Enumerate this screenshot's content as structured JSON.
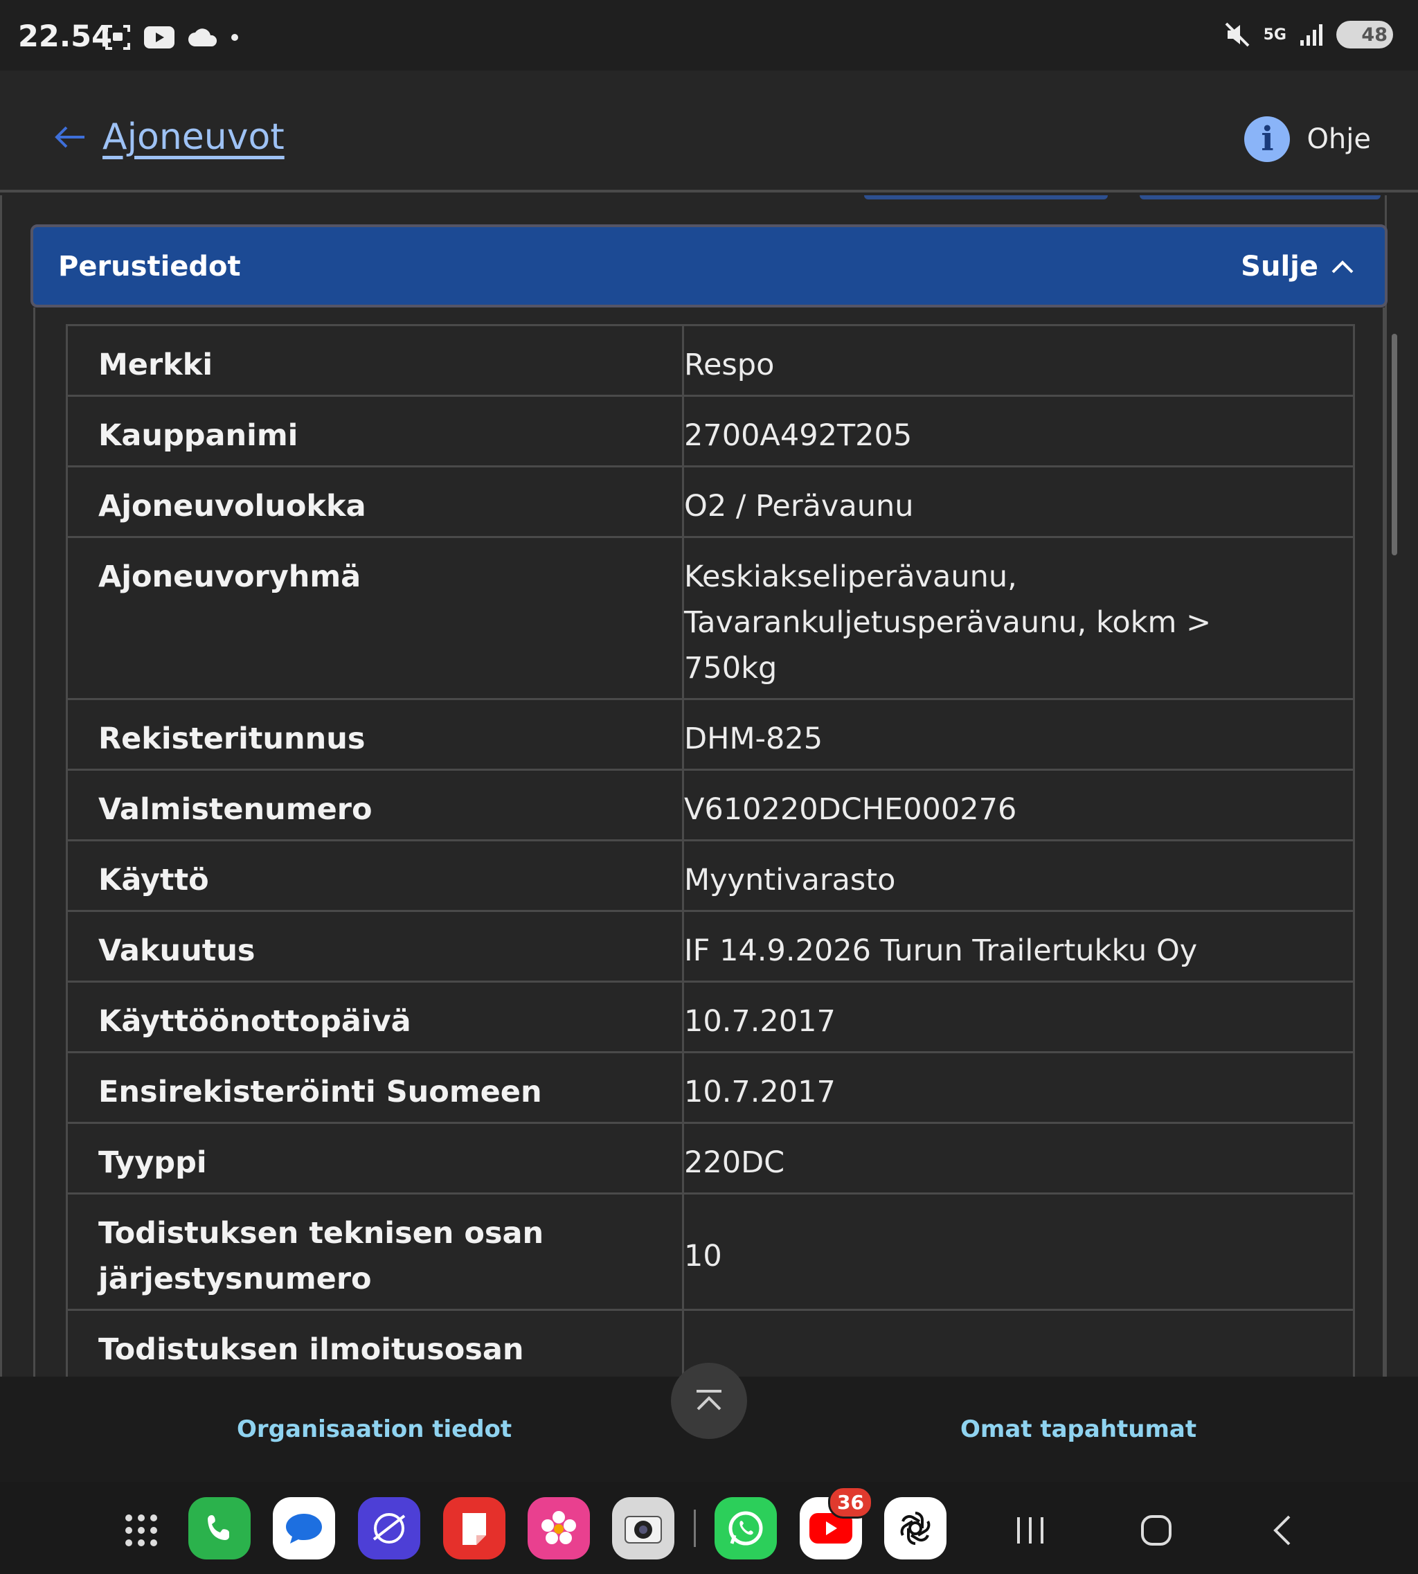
{
  "status_bar": {
    "time": "22.54",
    "network": "5G",
    "battery": "48"
  },
  "header": {
    "back_label": "Ajoneuvot",
    "help_label": "Ohje",
    "help_glyph": "i"
  },
  "section": {
    "title": "Perustiedot",
    "collapse_label": "Sulje"
  },
  "details": [
    {
      "label": "Merkki",
      "value": "Respo"
    },
    {
      "label": "Kauppanimi",
      "value": "2700A492T205"
    },
    {
      "label": "Ajoneuvoluokka",
      "value": "O2 / Perävaunu"
    },
    {
      "label": "Ajoneuvoryhmä",
      "value": "Keskiakseliperävaunu, Tavarankuljetusperävaunu, kokm > 750kg"
    },
    {
      "label": "Rekisteritunnus",
      "value": "DHM-825"
    },
    {
      "label": "Valmistenumero",
      "value": "V610220DCHE000276"
    },
    {
      "label": "Käyttö",
      "value": "Myyntivarasto"
    },
    {
      "label": "Vakuutus",
      "value": "IF 14.9.2026 Turun Trailertukku Oy"
    },
    {
      "label": "Käyttöönottopäivä",
      "value": "10.7.2017"
    },
    {
      "label": "Ensirekisteröinti Suomeen",
      "value": "10.7.2017"
    },
    {
      "label": "Tyyppi",
      "value": "220DC"
    },
    {
      "label": "Todistuksen teknisen osan järjestysnumero",
      "value": "10"
    },
    {
      "label": "Todistuksen ilmoitusosan",
      "value": ""
    }
  ],
  "bottom_nav": {
    "left_label": "Organisaation tiedot",
    "right_label": "Omat tapahtumat"
  },
  "dock": {
    "youtube_badge": "36"
  },
  "colors": {
    "accent_link": "#9ec2f5",
    "section_header": "#1c4a94",
    "nav_link": "#8fd3f0"
  }
}
